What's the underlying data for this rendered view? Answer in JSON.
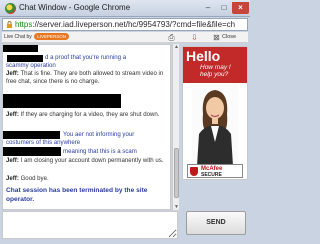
{
  "window": {
    "title": "Chat Window - Google Chrome",
    "minimize_glyph": "–",
    "maximize_glyph": "□",
    "close_glyph": "×"
  },
  "address_bar": {
    "scheme": "https",
    "rest": "://server.iad.liveperson.net/hc/9954793/?cmd=file&file=ch"
  },
  "toolbar": {
    "live_chat_label": "Live Chat by",
    "provider_label": "LIVEPERSON",
    "close_label": "Close",
    "icons": [
      "print-icon",
      "save-icon",
      "close-window-icon"
    ]
  },
  "messages": {
    "m1_visitor": "d a proof that you're running a",
    "m1_visitor_cont": "scammy operation",
    "m2_name": "Jeff:",
    "m2_text": " That is fine. They are both allowed to stream video in free chat, since there is no charge.",
    "m3_name": "Jeff:",
    "m3_text": " If they are charging for a video, they are shut down.",
    "m4_visitor": "You aer not informing your",
    "m4_visitor_cont": "costumers of this anywhere",
    "m5_visitor": "meaning that this is a scam",
    "m6_name": "Jeff:",
    "m6_text": " I am closing your account down permanently with us.",
    "m7_name": "Jeff:",
    "m7_text": " Good bye.",
    "system": "Chat session has been terminated by the site operator."
  },
  "ad": {
    "hello": "Hello",
    "subtitle": "How may I help you?",
    "badge_brand": "McAfee",
    "badge_label": "SECURE",
    "brand_color": "#c22a2a"
  },
  "composer": {
    "send_label": "SEND"
  },
  "colors": {
    "visitor_text": "#2b3ea0",
    "operator_text": "#333333",
    "accent": "#e87722"
  }
}
